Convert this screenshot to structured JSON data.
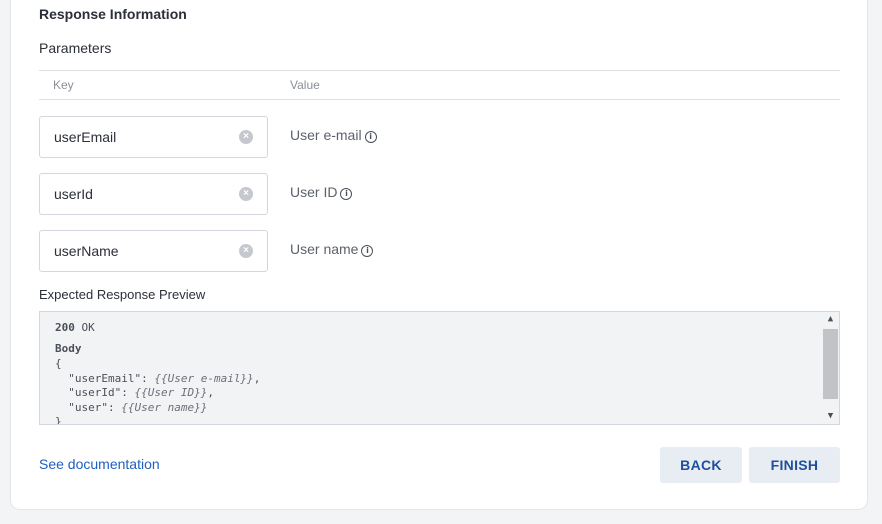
{
  "header": {
    "section_title": "Response Information",
    "parameters_title": "Parameters"
  },
  "table": {
    "col_key": "Key",
    "col_value": "Value",
    "rows": [
      {
        "key": "userEmail",
        "value": "User e-mail"
      },
      {
        "key": "userId",
        "value": "User ID"
      },
      {
        "key": "userName",
        "value": "User name"
      }
    ]
  },
  "preview": {
    "label": "Expected Response Preview",
    "status_code": "200",
    "status_text": "OK",
    "body_label": "Body",
    "lines": [
      {
        "text": "{",
        "template": ""
      },
      {
        "text": "  \"userEmail\": ",
        "template": "{{User e-mail}}",
        "suffix": ","
      },
      {
        "text": "  \"userId\": ",
        "template": "{{User ID}}",
        "suffix": ","
      },
      {
        "text": "  \"user\": ",
        "template": "{{User name}}",
        "suffix": ""
      },
      {
        "text": "}",
        "template": ""
      }
    ]
  },
  "footer": {
    "doc_link": "See documentation",
    "back_label": "BACK",
    "finish_label": "FINISH"
  },
  "icons": {
    "clear": "clear-circle-icon",
    "info": "info-circle-icon",
    "scroll_up": "chevron-up-icon",
    "scroll_down": "chevron-down-icon"
  },
  "colors": {
    "accent": "#1f5fbf",
    "button_bg": "#e8edf3",
    "button_text": "#1e4f9c"
  }
}
